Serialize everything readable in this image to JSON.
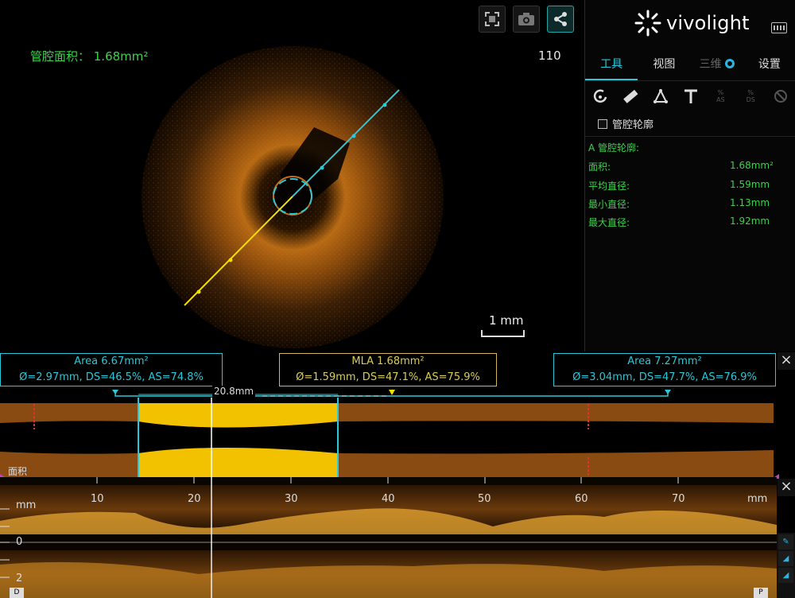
{
  "image_panel": {
    "area_readout": "管腔面积： 1.68mm²",
    "frame_number": "110",
    "scale_label": "1 mm",
    "buttons": [
      {
        "icon": "fullscreen-icon"
      },
      {
        "icon": "camera-icon"
      },
      {
        "icon": "share-icon"
      }
    ]
  },
  "sidebar": {
    "brand": "vivolight",
    "tabs": [
      {
        "label": "工具",
        "state": "active"
      },
      {
        "label": "视图",
        "state": "normal"
      },
      {
        "label": "三维",
        "state": "disabled"
      },
      {
        "label": "设置",
        "state": "normal"
      }
    ],
    "tools": [
      "lumen-contour-icon",
      "ruler-icon",
      "angle-icon",
      "text-icon",
      "as-percent-icon",
      "ds-percent-icon",
      "delete-icon"
    ],
    "tool_labels": {
      "as": "AS",
      "ds": "DS"
    },
    "checkbox_label": "管腔轮廓",
    "metrics_title": "A 管腔轮廓:",
    "metrics": [
      {
        "label": "面积:",
        "value": "1.68mm²"
      },
      {
        "label": "平均直径:",
        "value": "1.59mm"
      },
      {
        "label": "最小直径:",
        "value": "1.13mm"
      },
      {
        "label": "最大直径:",
        "value": "1.92mm"
      }
    ]
  },
  "annotations": {
    "left": {
      "line1": "Area 6.67mm²",
      "line2": "Ø=2.97mm, DS=46.5%, AS=74.8%"
    },
    "mla": {
      "line1": "MLA 1.68mm²",
      "line2": "Ø=1.59mm, DS=47.1%, AS=75.9%"
    },
    "right": {
      "line1": "Area 7.27mm²",
      "line2": "Ø=3.04mm, DS=47.7%, AS=76.9%"
    },
    "measure_length": "20.8mm"
  },
  "profile": {
    "side_label": "面积"
  },
  "longitudinal": {
    "unit_left": "mm",
    "unit_right": "mm",
    "tick_labels": [
      "10",
      "20",
      "30",
      "40",
      "50",
      "60",
      "70"
    ],
    "depth_labels": [
      "0",
      "2"
    ],
    "corner_left": "D",
    "corner_right": "P"
  },
  "colors": {
    "accent": "#2ac7d8",
    "metric_green": "#3ad24a",
    "lumen_fill": "#8a4b12",
    "highlight_fill": "#f2c200",
    "mla_yellow": "#e8e000"
  }
}
